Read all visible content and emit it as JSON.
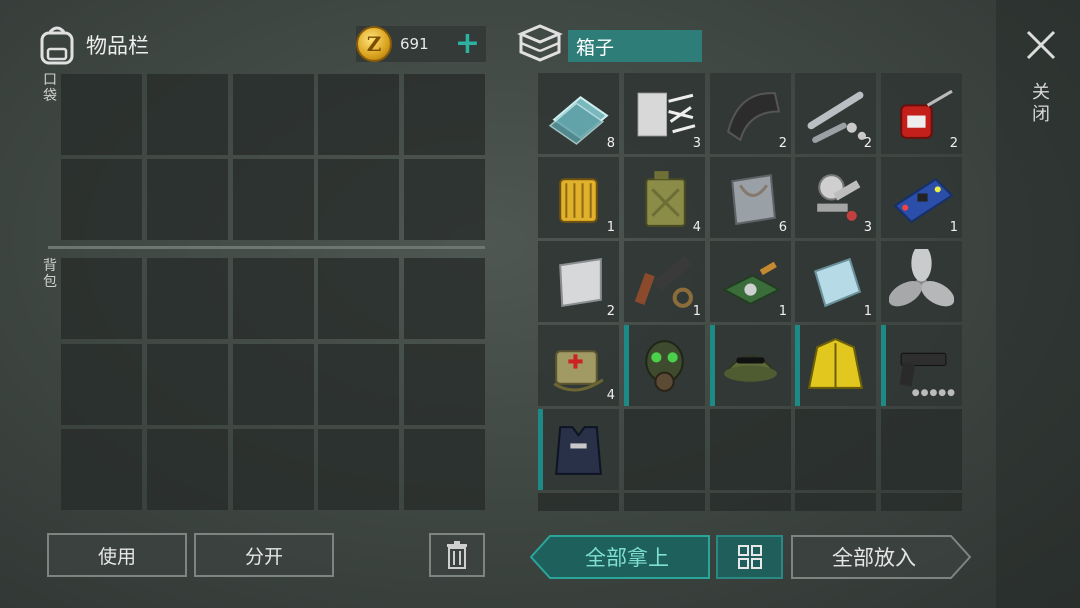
{
  "inventory": {
    "title": "物品栏",
    "pocket_label": "口袋",
    "backpack_label": "背包",
    "currency": {
      "amount": "691",
      "coin_symbol": "Z",
      "add_label": "+"
    },
    "use_label": "使用",
    "split_label": "分开"
  },
  "box": {
    "name": "箱子",
    "close_label": "关闭",
    "take_all_label": "全部拿上",
    "store_all_label": "全部放入",
    "items": [
      {
        "name": "glass-sheets",
        "qty": "8"
      },
      {
        "name": "cloth-and-rope",
        "qty": "3"
      },
      {
        "name": "rubber-sheet",
        "qty": "2"
      },
      {
        "name": "pipes-and-nuts",
        "qty": "2"
      },
      {
        "name": "oil-can",
        "qty": "2"
      },
      {
        "name": "oil-filter",
        "qty": "1"
      },
      {
        "name": "jerrycan",
        "qty": "4"
      },
      {
        "name": "steel-plate",
        "qty": "6"
      },
      {
        "name": "engine-parts",
        "qty": "3"
      },
      {
        "name": "circuit-board",
        "qty": "1"
      },
      {
        "name": "aluminum-plate",
        "qty": "2"
      },
      {
        "name": "gun-parts",
        "qty": "1"
      },
      {
        "name": "electronic-component",
        "qty": "1"
      },
      {
        "name": "glass-plate",
        "qty": "1"
      },
      {
        "name": "propeller",
        "qty": ""
      },
      {
        "name": "first-aid-bag",
        "qty": "4"
      },
      {
        "name": "gas-mask",
        "qty": ""
      },
      {
        "name": "military-cap",
        "qty": ""
      },
      {
        "name": "yellow-raincoat",
        "qty": ""
      },
      {
        "name": "pistol",
        "qty": ""
      },
      {
        "name": "police-vest",
        "qty": ""
      }
    ]
  },
  "colors": {
    "accent": "#2db2a1",
    "box_name_bg": "#2e7d78",
    "durability_bar": "#1d8a85"
  }
}
